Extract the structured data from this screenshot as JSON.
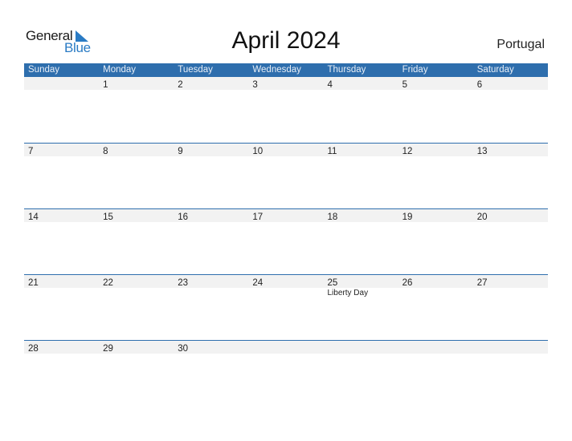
{
  "logo": {
    "line1": "General",
    "line2": "Blue"
  },
  "title": "April 2024",
  "country": "Portugal",
  "colors": {
    "header_bg": "#2e6ead",
    "date_strip_bg": "#f2f2f2",
    "logo_blue": "#2a7bc4"
  },
  "weekdays": [
    "Sunday",
    "Monday",
    "Tuesday",
    "Wednesday",
    "Thursday",
    "Friday",
    "Saturday"
  ],
  "weeks": [
    {
      "days": [
        "",
        "1",
        "2",
        "3",
        "4",
        "5",
        "6"
      ],
      "events": [
        "",
        "",
        "",
        "",
        "",
        "",
        ""
      ]
    },
    {
      "days": [
        "7",
        "8",
        "9",
        "10",
        "11",
        "12",
        "13"
      ],
      "events": [
        "",
        "",
        "",
        "",
        "",
        "",
        ""
      ]
    },
    {
      "days": [
        "14",
        "15",
        "16",
        "17",
        "18",
        "19",
        "20"
      ],
      "events": [
        "",
        "",
        "",
        "",
        "",
        "",
        ""
      ]
    },
    {
      "days": [
        "21",
        "22",
        "23",
        "24",
        "25",
        "26",
        "27"
      ],
      "events": [
        "",
        "",
        "",
        "",
        "Liberty Day",
        "",
        ""
      ]
    },
    {
      "days": [
        "28",
        "29",
        "30",
        "",
        "",
        "",
        ""
      ],
      "events": [
        "",
        "",
        "",
        "",
        "",
        "",
        ""
      ]
    }
  ]
}
